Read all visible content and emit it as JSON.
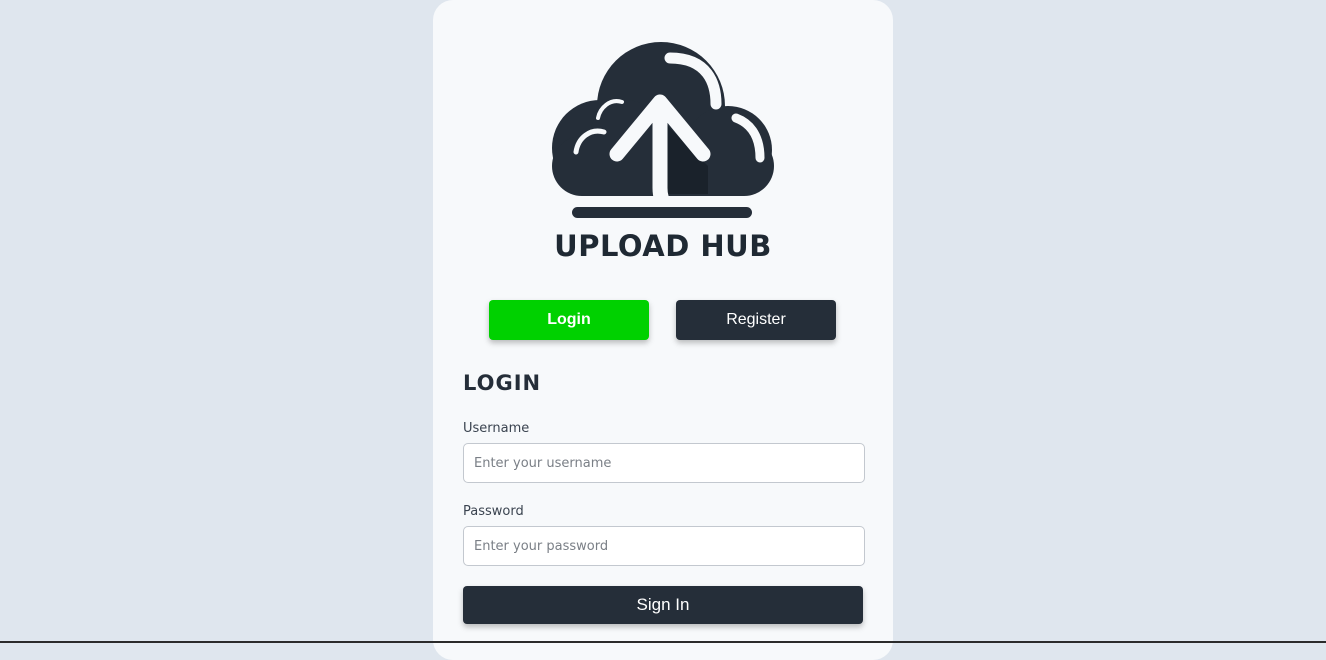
{
  "brand": {
    "name": "UPLOAD HUB",
    "logo_icon": "cloud-upload-icon"
  },
  "tabs": {
    "login_label": "Login",
    "register_label": "Register",
    "active": "Login"
  },
  "form": {
    "title": "LOGIN",
    "username_label": "Username",
    "username_placeholder": "Enter your username",
    "username_value": "",
    "password_label": "Password",
    "password_placeholder": "Enter your password",
    "password_value": "",
    "submit_label": "Sign In"
  },
  "colors": {
    "page_background": "#dfe6ee",
    "card_background": "#f7f9fb",
    "accent_green": "#00d100",
    "dark": "#252e39"
  }
}
